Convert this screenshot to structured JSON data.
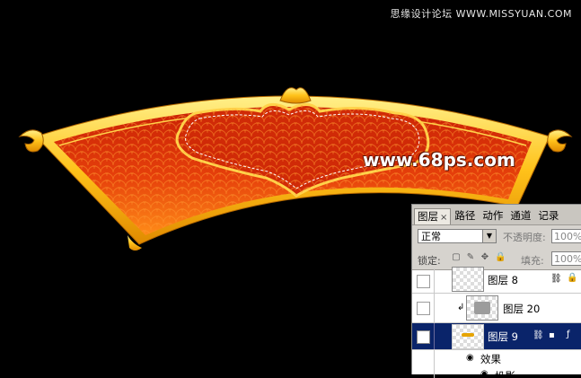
{
  "watermark_top": "思缘设计论坛 WWW.MISSYUAN.COM",
  "watermark_mid": "www.68ps.com",
  "colors": {
    "gold": "#ffc21a",
    "red": "#e03a0a",
    "orange": "#ff8a1e",
    "panel_bg": "#d6d3ce",
    "selected": "#0a246a"
  },
  "panel": {
    "tabs": [
      {
        "label": "图层",
        "close": "×"
      },
      {
        "label": "路径"
      },
      {
        "label": "动作"
      },
      {
        "label": "通道"
      },
      {
        "label": "记录"
      }
    ],
    "blend_mode": "正常",
    "opacity_label": "不透明度:",
    "opacity_value": "100%",
    "lock_label": "锁定:",
    "fill_label": "填充:",
    "fill_value": "100%",
    "layers": [
      {
        "name": "图层 8"
      },
      {
        "name": "图层 20"
      },
      {
        "name": "图层 9"
      },
      {
        "name": "效果"
      },
      {
        "name": "投影"
      }
    ]
  }
}
